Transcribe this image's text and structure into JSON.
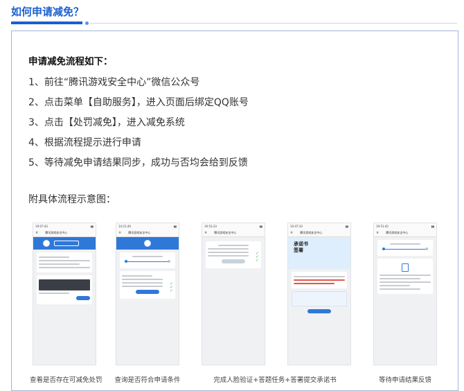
{
  "heading": "如何申请减免？",
  "process_title": "申请减免流程如下：",
  "steps": [
    "1、前往“腾讯游戏安全中心”微信公众号",
    "2、点击菜单【自助服务】，进入页面后绑定QQ账号",
    "3、点击【处罚减免】，进入减免系统",
    "4、根据流程提示进行申请",
    "5、等待减免申请结果同步，成功与否均会给到反馈"
  ],
  "diagram_title": "附具体流程示意图：",
  "phones": [
    {
      "time": "19:07:43",
      "app_title": "腾讯游戏安全中心",
      "hero": ""
    },
    {
      "time": "14:21:40",
      "app_title": "腾讯游戏安全中心",
      "hero": ""
    },
    {
      "time": "19:53:33",
      "app_title": "腾讯游戏安全中心",
      "hero": ""
    },
    {
      "time": "10:47:33",
      "app_title": "腾讯游戏安全中心",
      "hero": "承诺书\n签署"
    },
    {
      "time": "19:51:42",
      "app_title": "腾讯游戏安全中心",
      "hero": ""
    }
  ],
  "captions": [
    "查看是否存在可减免处罚",
    "查询是否符合申请条件",
    "完成人脸验证+答题任务+答署提交承诺书",
    "等待申请结果反馈"
  ],
  "colors": {
    "accent": "#1a5fd0",
    "brand_blue": "#2f78d8",
    "panel_border": "#9fb6d8"
  }
}
